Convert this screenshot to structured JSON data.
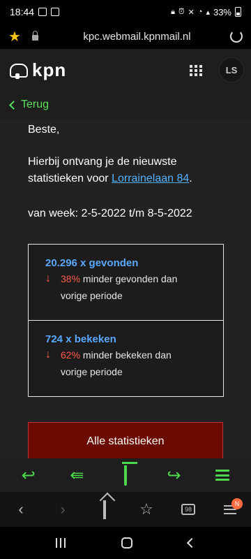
{
  "status_bar": {
    "time": "18:44",
    "battery": "33%"
  },
  "browser": {
    "url": "kpc.webmail.kpnmail.nl"
  },
  "header": {
    "brand": "kpn",
    "avatar_initials": "LS"
  },
  "nav": {
    "back_label": "Terug"
  },
  "email": {
    "greeting": "Beste,",
    "intro_text": "Hierbij ontvang je de nieuwste statistieken voor ",
    "address_link": "Lorrainelaan 84",
    "intro_end": ".",
    "week_text": "van week: 2-5-2022 t/m 8-5-2022",
    "stats": [
      {
        "title": "20.296 x gevonden",
        "percent": "38%",
        "description": " minder gevonden dan vorige periode"
      },
      {
        "title": "724 x bekeken",
        "percent": "62%",
        "description": " minder bekeken dan vorige periode"
      }
    ],
    "cta_label": "Alle statistieken"
  },
  "browser_nav": {
    "tabs_count": "98",
    "notification_badge": "N"
  },
  "colors": {
    "accent_green": "#4bd94b",
    "link_blue": "#53b1ff",
    "stat_blue": "#5aa9ff",
    "decline_red": "#ff5a4a",
    "cta_bg": "#6a0a00"
  },
  "icons": [
    "star-icon",
    "lock-icon",
    "reload-icon",
    "crown-icon",
    "grid-icon",
    "chevron-left-icon",
    "arrow-down-icon",
    "reply-icon",
    "reply-all-icon",
    "trash-icon",
    "forward-icon",
    "menu-icon",
    "home-icon",
    "bookmark-icon",
    "tabs-icon"
  ]
}
